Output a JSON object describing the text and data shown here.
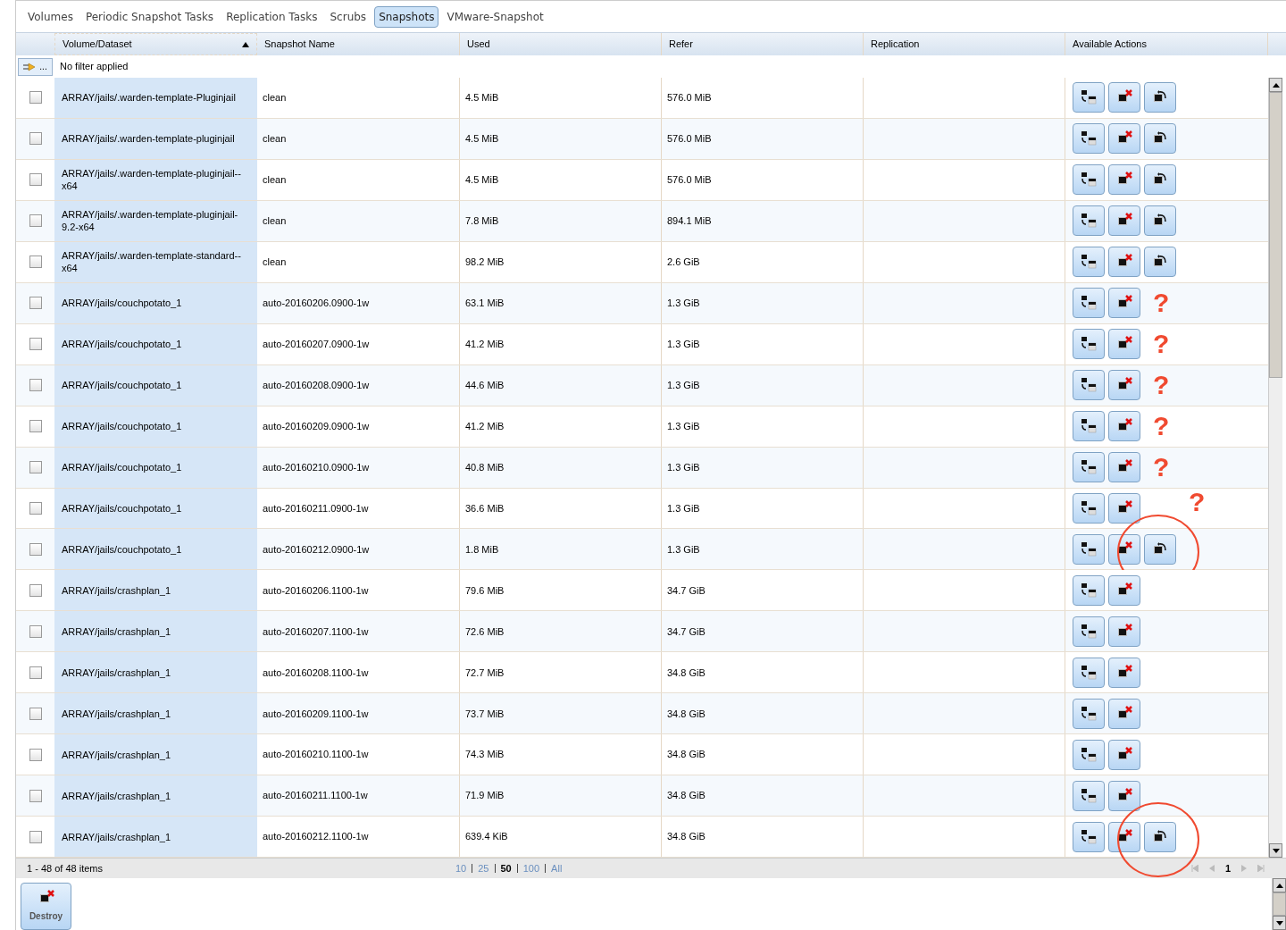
{
  "tabs": [
    {
      "label": "Volumes",
      "selected": false
    },
    {
      "label": "Periodic Snapshot Tasks",
      "selected": false
    },
    {
      "label": "Replication Tasks",
      "selected": false
    },
    {
      "label": "Scrubs",
      "selected": false
    },
    {
      "label": "Snapshots",
      "selected": true
    },
    {
      "label": "VMware-Snapshot",
      "selected": false
    }
  ],
  "table": {
    "columns": [
      "Volume/Dataset",
      "Snapshot Name",
      "Used",
      "Refer",
      "Replication",
      "Available Actions"
    ],
    "filter": {
      "button": "...",
      "text": "No filter applied"
    },
    "rows": [
      {
        "checked": false,
        "dataset": "ARRAY/jails/.warden-template-Pluginjail",
        "snapshot": "clean",
        "used": "4.5 MiB",
        "refer": "576.0 MiB",
        "rollback": true,
        "circled": false
      },
      {
        "checked": false,
        "dataset": "ARRAY/jails/.warden-template-pluginjail",
        "snapshot": "clean",
        "used": "4.5 MiB",
        "refer": "576.0 MiB",
        "rollback": true,
        "circled": false
      },
      {
        "checked": false,
        "dataset": "ARRAY/jails/.warden-template-pluginjail--x64",
        "snapshot": "clean",
        "used": "4.5 MiB",
        "refer": "576.0 MiB",
        "rollback": true,
        "circled": false
      },
      {
        "checked": false,
        "dataset": "ARRAY/jails/.warden-template-pluginjail-9.2-x64",
        "snapshot": "clean",
        "used": "7.8 MiB",
        "refer": "894.1 MiB",
        "rollback": true,
        "circled": false
      },
      {
        "checked": false,
        "dataset": "ARRAY/jails/.warden-template-standard--x64",
        "snapshot": "clean",
        "used": "98.2 MiB",
        "refer": "2.6 GiB",
        "rollback": true,
        "circled": false
      },
      {
        "checked": false,
        "dataset": "ARRAY/jails/couchpotato_1",
        "snapshot": "auto-20160206.0900-1w",
        "used": "63.1 MiB",
        "refer": "1.3 GiB",
        "rollback": false,
        "note": "?",
        "circled": false
      },
      {
        "checked": false,
        "dataset": "ARRAY/jails/couchpotato_1",
        "snapshot": "auto-20160207.0900-1w",
        "used": "41.2 MiB",
        "refer": "1.3 GiB",
        "rollback": false,
        "note": "?",
        "circled": false
      },
      {
        "checked": false,
        "dataset": "ARRAY/jails/couchpotato_1",
        "snapshot": "auto-20160208.0900-1w",
        "used": "44.6 MiB",
        "refer": "1.3 GiB",
        "rollback": false,
        "note": "?",
        "circled": false
      },
      {
        "checked": false,
        "dataset": "ARRAY/jails/couchpotato_1",
        "snapshot": "auto-20160209.0900-1w",
        "used": "41.2 MiB",
        "refer": "1.3 GiB",
        "rollback": false,
        "note": "?",
        "circled": false
      },
      {
        "checked": false,
        "dataset": "ARRAY/jails/couchpotato_1",
        "snapshot": "auto-20160210.0900-1w",
        "used": "40.8 MiB",
        "refer": "1.3 GiB",
        "rollback": false,
        "note": "?",
        "circled": false
      },
      {
        "checked": false,
        "dataset": "ARRAY/jails/couchpotato_1",
        "snapshot": "auto-20160211.0900-1w",
        "used": "36.6 MiB",
        "refer": "1.3 GiB",
        "rollback": false,
        "note": "?",
        "circled": false
      },
      {
        "checked": false,
        "dataset": "ARRAY/jails/couchpotato_1",
        "snapshot": "auto-20160212.0900-1w",
        "used": "1.8 MiB",
        "refer": "1.3 GiB",
        "rollback": true,
        "circled": true
      },
      {
        "checked": false,
        "dataset": "ARRAY/jails/crashplan_1",
        "snapshot": "auto-20160206.1100-1w",
        "used": "79.6 MiB",
        "refer": "34.7 GiB",
        "rollback": false,
        "circled": false
      },
      {
        "checked": false,
        "dataset": "ARRAY/jails/crashplan_1",
        "snapshot": "auto-20160207.1100-1w",
        "used": "72.6 MiB",
        "refer": "34.7 GiB",
        "rollback": false,
        "circled": false
      },
      {
        "checked": false,
        "dataset": "ARRAY/jails/crashplan_1",
        "snapshot": "auto-20160208.1100-1w",
        "used": "72.7 MiB",
        "refer": "34.8 GiB",
        "rollback": false,
        "circled": false
      },
      {
        "checked": false,
        "dataset": "ARRAY/jails/crashplan_1",
        "snapshot": "auto-20160209.1100-1w",
        "used": "73.7 MiB",
        "refer": "34.8 GiB",
        "rollback": false,
        "circled": false
      },
      {
        "checked": false,
        "dataset": "ARRAY/jails/crashplan_1",
        "snapshot": "auto-20160210.1100-1w",
        "used": "74.3 MiB",
        "refer": "34.8 GiB",
        "rollback": false,
        "circled": false
      },
      {
        "checked": false,
        "dataset": "ARRAY/jails/crashplan_1",
        "snapshot": "auto-20160211.1100-1w",
        "used": "71.9 MiB",
        "refer": "34.8 GiB",
        "rollback": false,
        "circled": false
      },
      {
        "checked": false,
        "dataset": "ARRAY/jails/crashplan_1",
        "snapshot": "auto-20160212.1100-1w",
        "used": "639.4 KiB",
        "refer": "34.8 GiB",
        "rollback": true,
        "circled": true
      }
    ]
  },
  "footer": {
    "count": "1 - 48 of 48 items",
    "page_sizes": [
      {
        "label": "10",
        "selected": false
      },
      {
        "label": "25",
        "selected": false
      },
      {
        "label": "50",
        "selected": true
      },
      {
        "label": "100",
        "selected": false
      },
      {
        "label": "All",
        "selected": false
      }
    ],
    "page": "1"
  },
  "destroy_button": "Destroy"
}
